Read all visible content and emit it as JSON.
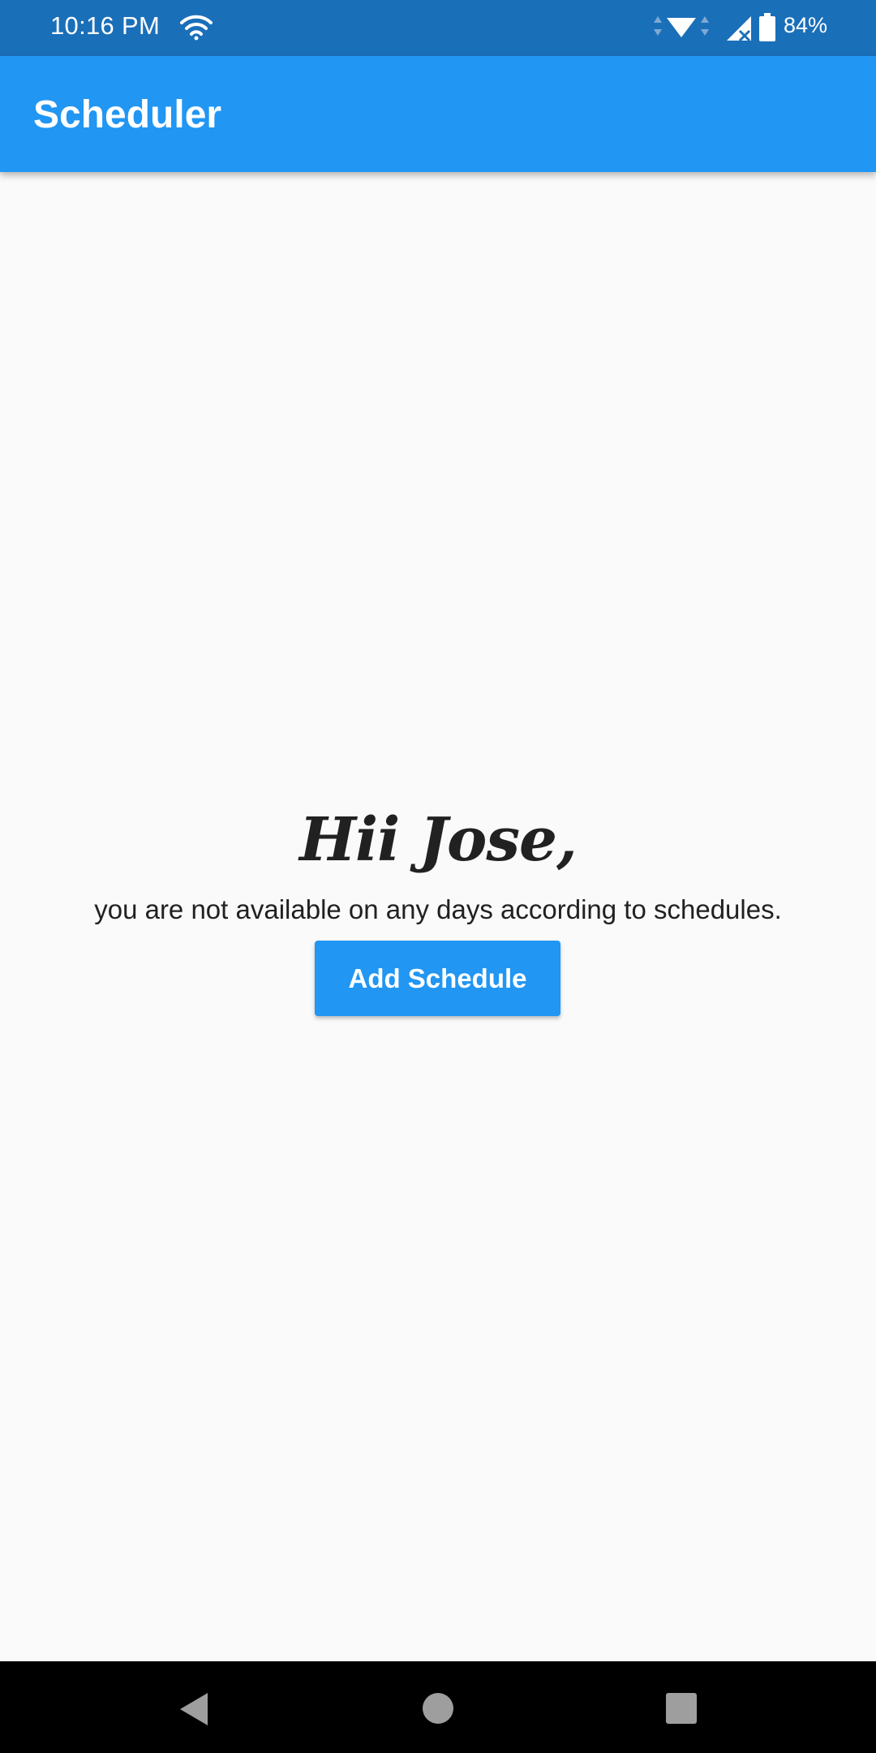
{
  "status_bar": {
    "time": "10:16 PM",
    "battery": "84%",
    "icons": [
      "wifi-icon",
      "data-arrows-icon",
      "signal-icon",
      "battery-icon"
    ]
  },
  "app_bar": {
    "title": "Scheduler",
    "color": "#2196f3"
  },
  "main": {
    "greeting": "Hii Jose,",
    "message": "you are not available on any days according to schedules.",
    "add_button_label": "Add Schedule"
  },
  "nav_bar": {
    "icons": [
      "back-icon",
      "home-icon",
      "recents-icon"
    ]
  },
  "colors": {
    "status_bar": "#1a6fb9",
    "accent": "#2196f3",
    "background": "#fafafa",
    "text": "#212121"
  }
}
